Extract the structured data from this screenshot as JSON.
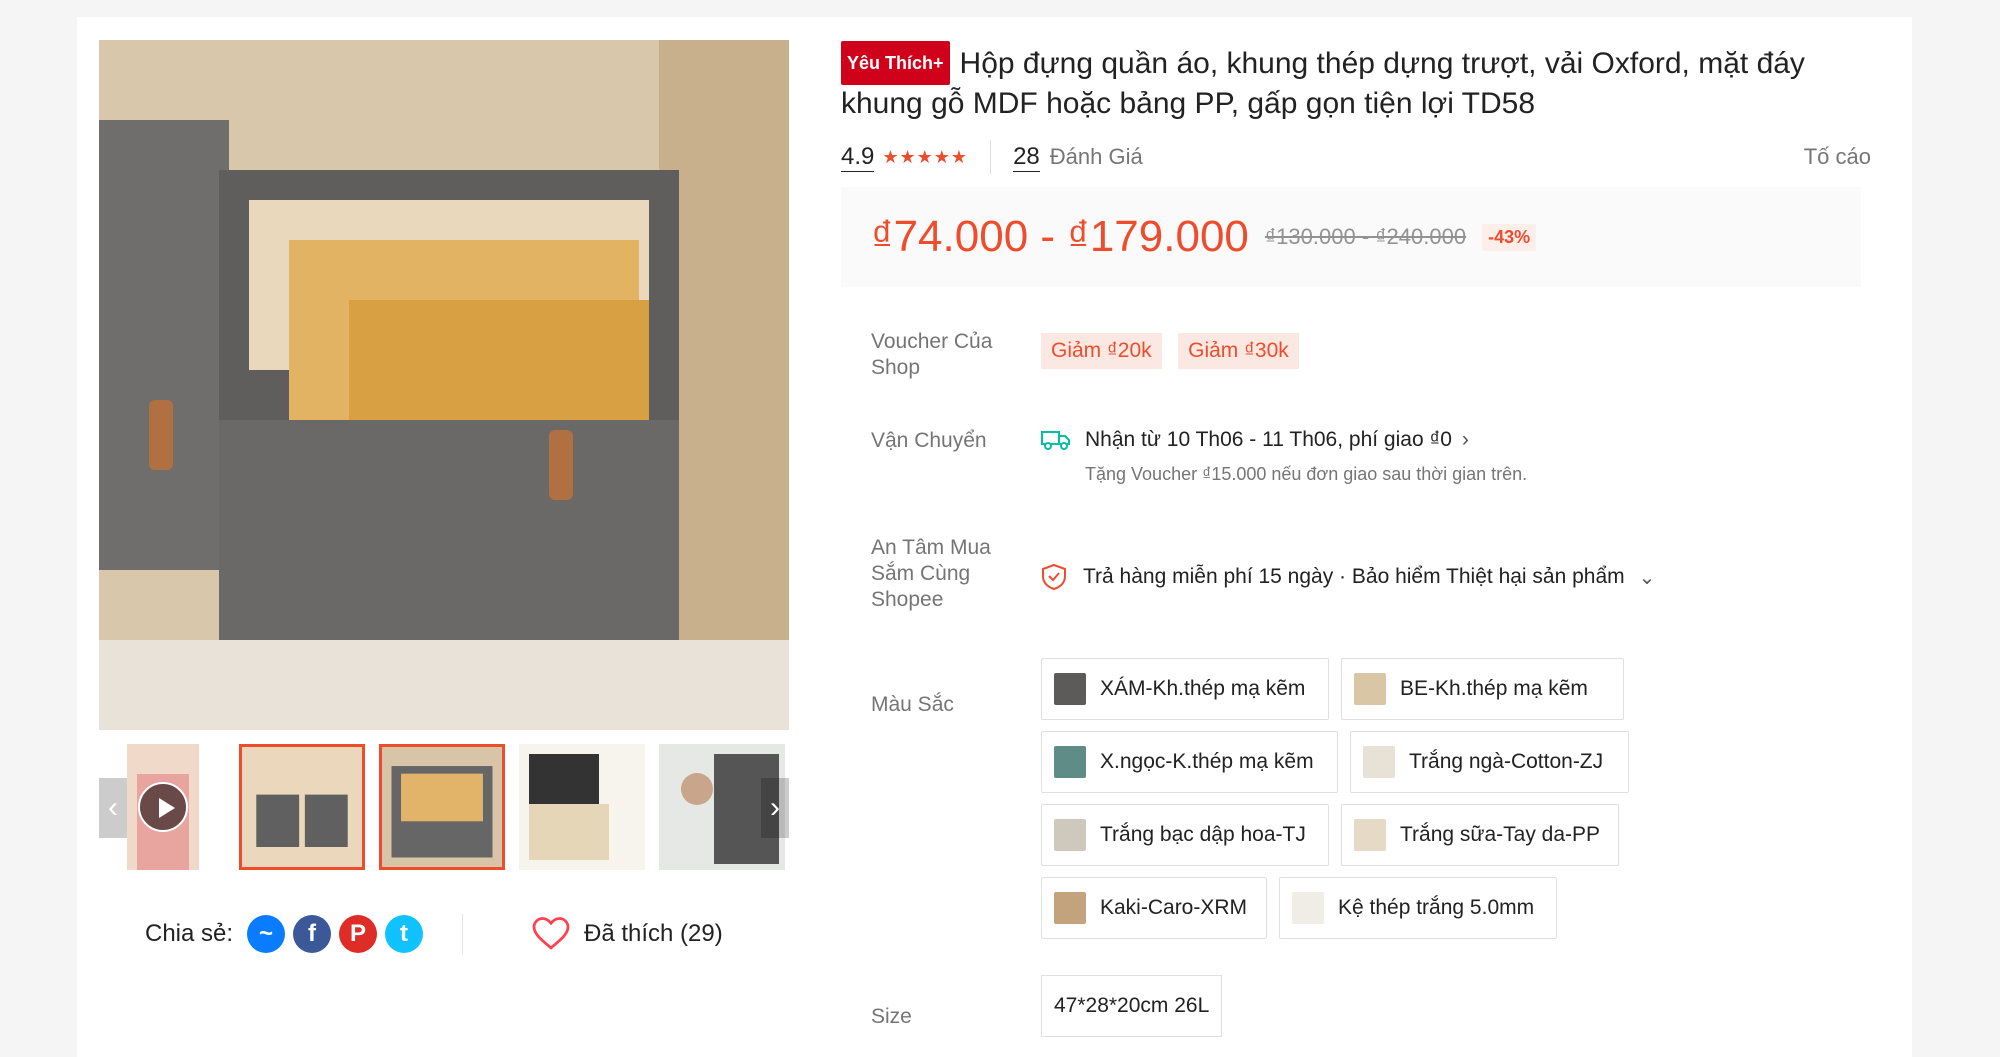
{
  "product": {
    "badge": "Yêu Thích+",
    "title": "Hộp đựng quần áo, khung thép dựng trượt, vải Oxford, mặt đáy khung gỗ MDF hoặc bảng PP, gấp gọn tiện lợi TD58",
    "rating": "4.9",
    "stars": "★★★★★",
    "review_count": "28",
    "review_label": "Đánh Giá",
    "report_label": "Tố cáo"
  },
  "price": {
    "current": "₫74.000 - ₫179.000",
    "original": "₫130.000 - ₫240.000",
    "discount": "-43%"
  },
  "voucher": {
    "label": "Voucher Của Shop",
    "items": [
      "Giảm ₫20k",
      "Giảm ₫30k"
    ]
  },
  "shipping": {
    "label": "Vận Chuyển",
    "text": "Nhận từ 10 Th06 - 11 Th06, phí giao ₫0",
    "sub": "Tặng Voucher ₫15.000 nếu đơn giao sau thời gian trên."
  },
  "assurance": {
    "label": "An Tâm Mua Sắm Cùng Shopee",
    "text": "Trả hàng miễn phí 15 ngày · Bảo hiểm Thiệt hại sản phẩm"
  },
  "color": {
    "label": "Màu Sắc",
    "options": [
      "XÁM-Kh.thép mạ kẽm",
      "BE-Kh.thép mạ kẽm",
      "X.ngọc-K.thép mạ kẽm",
      "Trắng ngà-Cotton-ZJ",
      "Trắng bạc dập hoa-TJ",
      "Trắng sữa-Tay da-PP",
      "Kaki-Caro-XRM",
      "Kệ thép trắng 5.0mm"
    ]
  },
  "size": {
    "label": "Size",
    "options": [
      "47*28*20cm 26L"
    ]
  },
  "share": {
    "label": "Chia sẻ:",
    "liked": "Đã thích (29)"
  },
  "colors": {
    "accent": "#ee4d2d",
    "badge": "#d0011b"
  }
}
